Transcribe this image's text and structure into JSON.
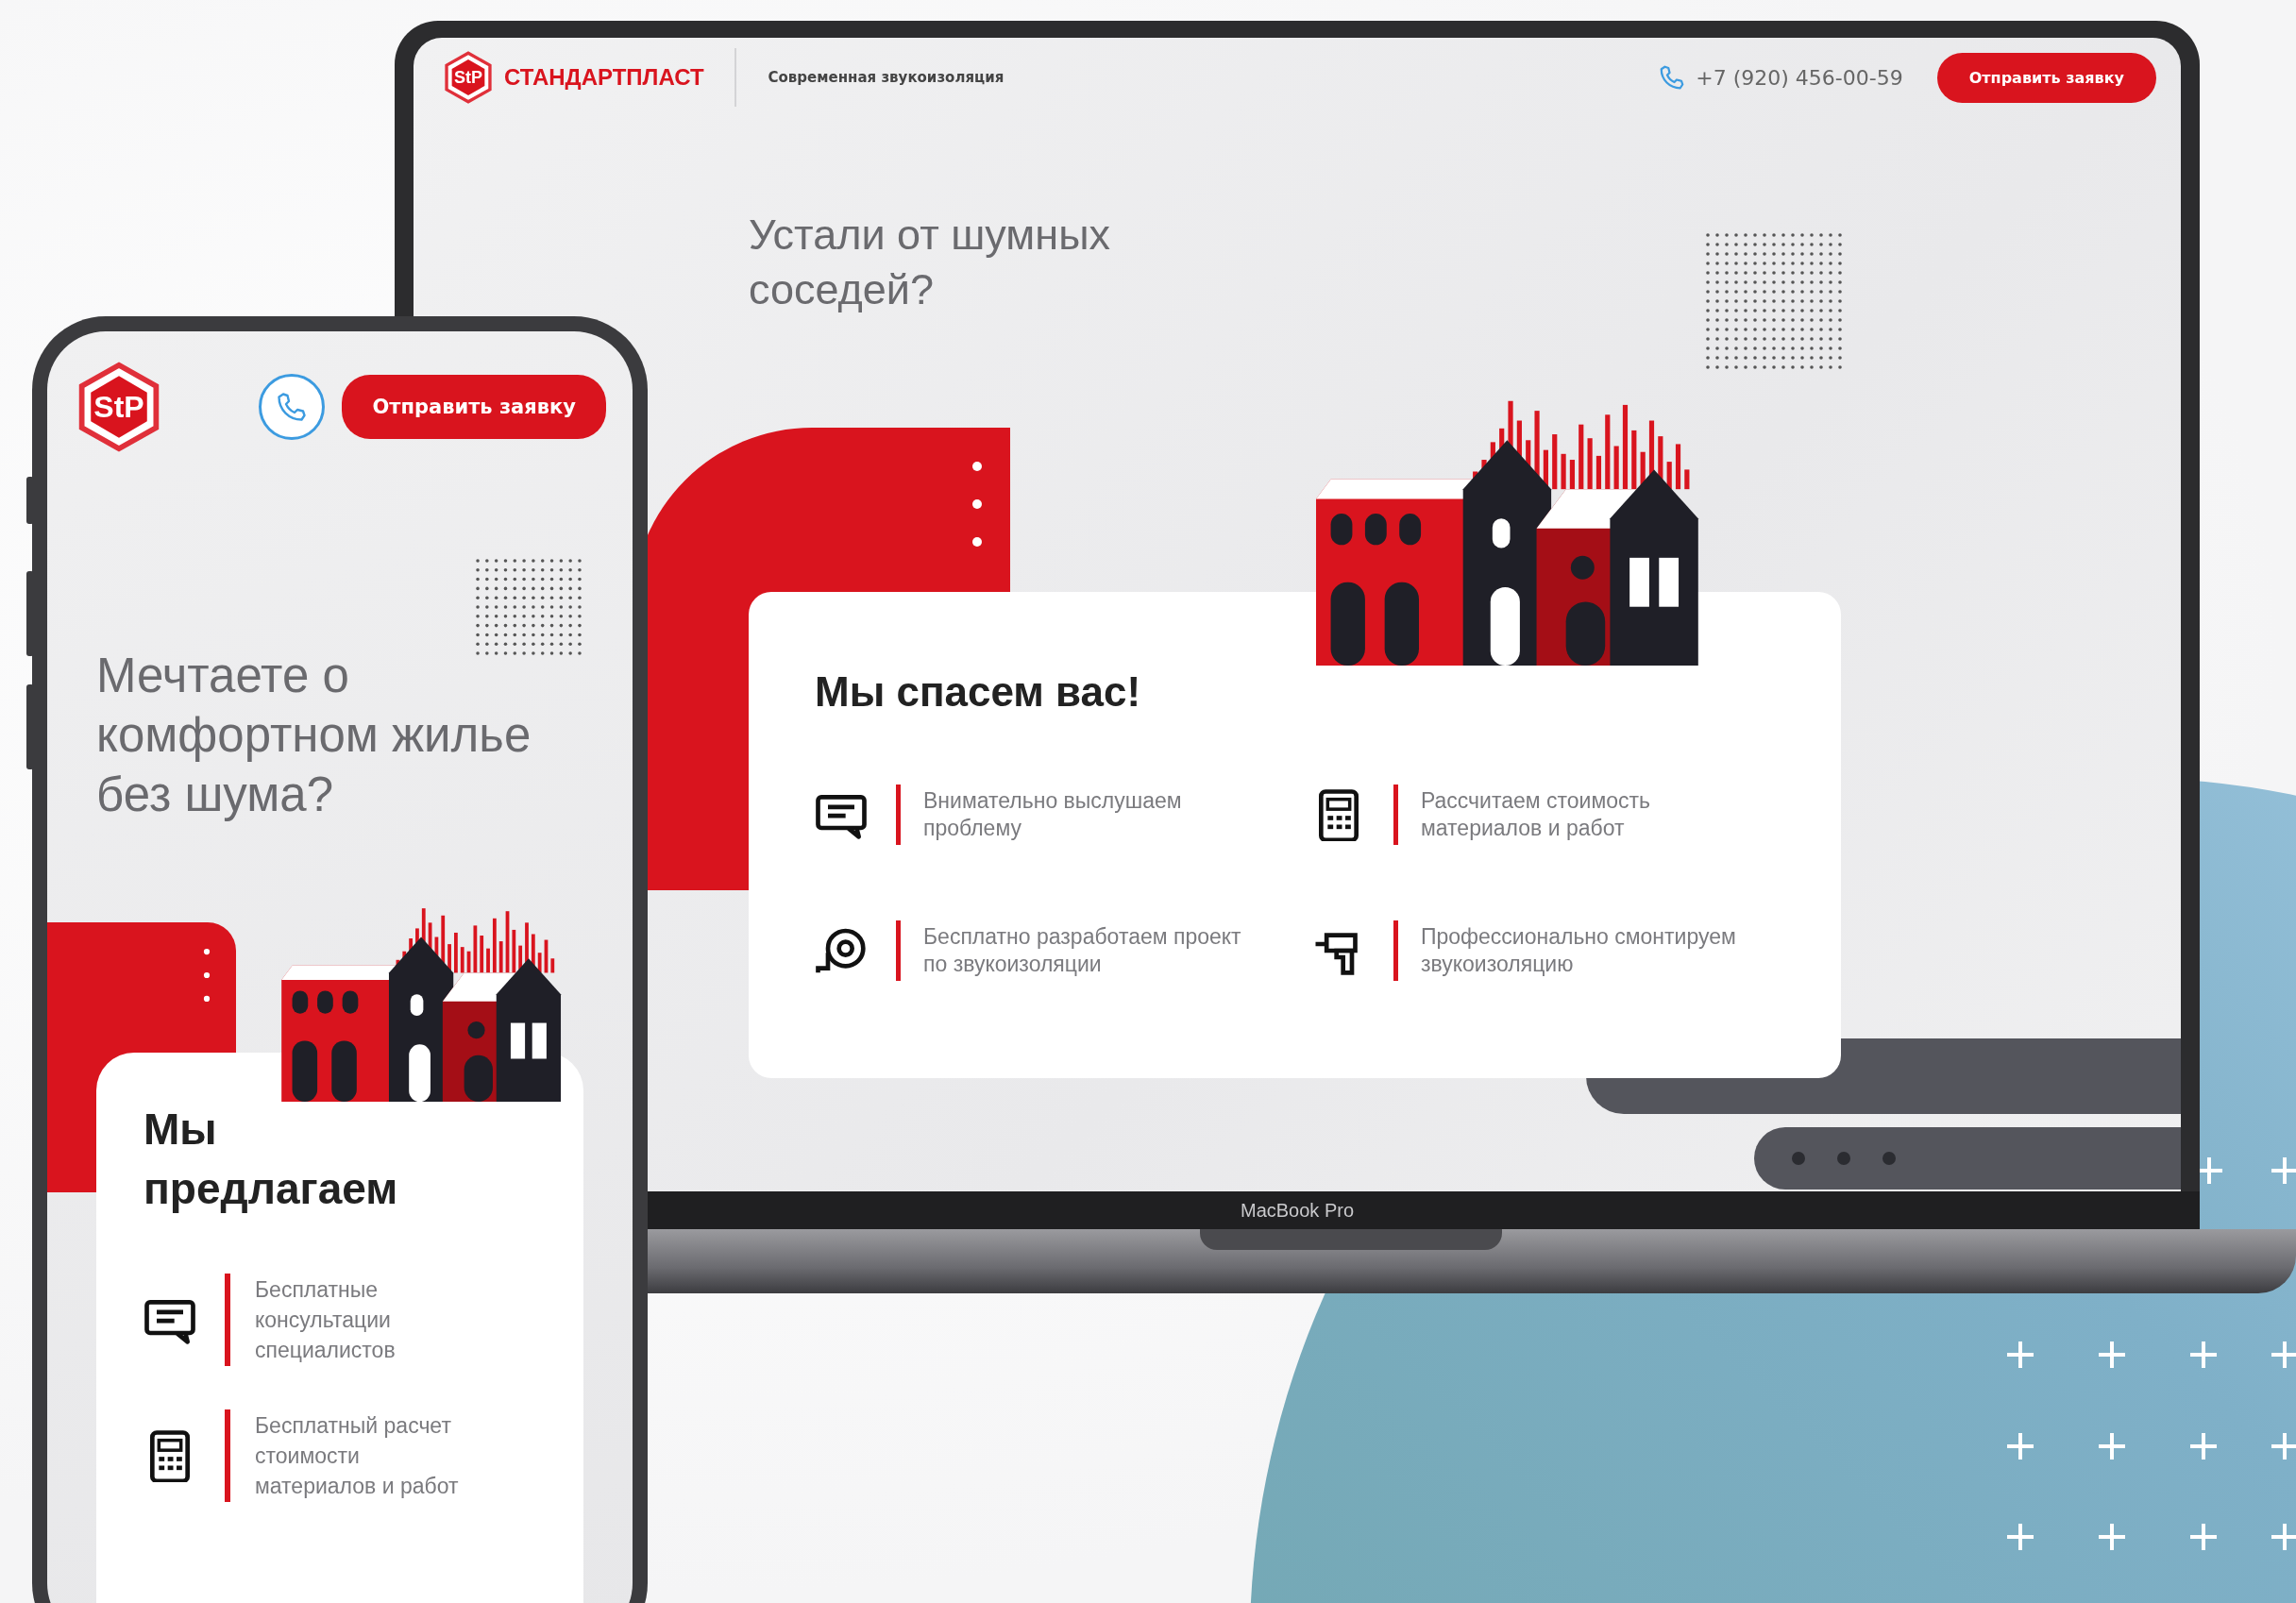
{
  "laptop": {
    "label": "MacBook Pro",
    "header": {
      "logo_mark": "StP",
      "brand": "СТАНДАРТПЛАСТ",
      "tagline": "Современная звукоизоляция",
      "phone": "+7 (920) 456-00-59",
      "button": "Отправить заявку"
    },
    "hero": {
      "heading": "Устали от шумных\nсоседей?"
    },
    "card": {
      "title": "Мы спасем вас!",
      "features": [
        {
          "kind": "chat",
          "text": "Внимательно выслушаем\nпроблему"
        },
        {
          "kind": "calculator",
          "text": "Рассчитаем стоимость\nматериалов и работ"
        },
        {
          "kind": "tape",
          "text": "Бесплатно разработаем проект\nпо звукоизоляции"
        },
        {
          "kind": "drill",
          "text": "Профессионально смонтируем\nзвукоизоляцию"
        }
      ]
    }
  },
  "phone": {
    "header": {
      "logo_mark": "StP",
      "button": "Отправить заявку"
    },
    "hero": {
      "heading": "Мечтаете о\nкомфортном жилье\nбез шума?"
    },
    "card": {
      "title": "Мы\nпредлагаем",
      "features": [
        {
          "kind": "chat",
          "text": "Бесплатные\nконсультации\nспециалистов"
        },
        {
          "kind": "calculator",
          "text": "Бесплатный расчет\nстоимости\nматериалов и работ"
        }
      ]
    }
  }
}
